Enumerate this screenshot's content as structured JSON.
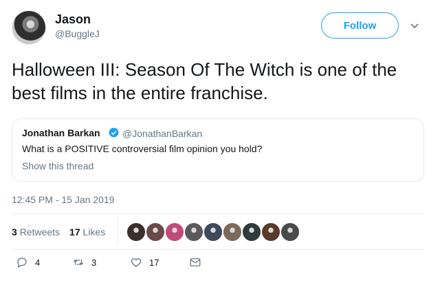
{
  "tweet": {
    "author_name": "Jason",
    "author_handle": "@BuggleJ",
    "follow_label": "Follow",
    "text": "Halloween III: Season Of The Witch is one of the best films in the entire franchise.",
    "timestamp": "12:45 PM - 15 Jan 2019"
  },
  "quote": {
    "author_name": "Jonathan Barkan",
    "author_handle": "@JonathanBarkan",
    "text": "What is a POSITIVE controversial film opinion you hold?",
    "show_thread": "Show this thread"
  },
  "stats": {
    "retweets_count": "3",
    "retweets_label": "Retweets",
    "likes_count": "17",
    "likes_label": "Likes"
  },
  "likers": [
    {
      "color": "#3b2f2a"
    },
    {
      "color": "#6b4a4a"
    },
    {
      "color": "#c24a7a"
    },
    {
      "color": "#5a5a5a"
    },
    {
      "color": "#3d4a5c"
    },
    {
      "color": "#7b6a5a"
    },
    {
      "color": "#2f3a3a"
    },
    {
      "color": "#5a3a2a"
    },
    {
      "color": "#4a4a4a"
    }
  ],
  "actions": {
    "replies": "4",
    "retweets": "3",
    "likes": "17"
  },
  "colors": {
    "accent": "#1da1f2",
    "muted": "#657786",
    "border": "#e1e8ed"
  }
}
